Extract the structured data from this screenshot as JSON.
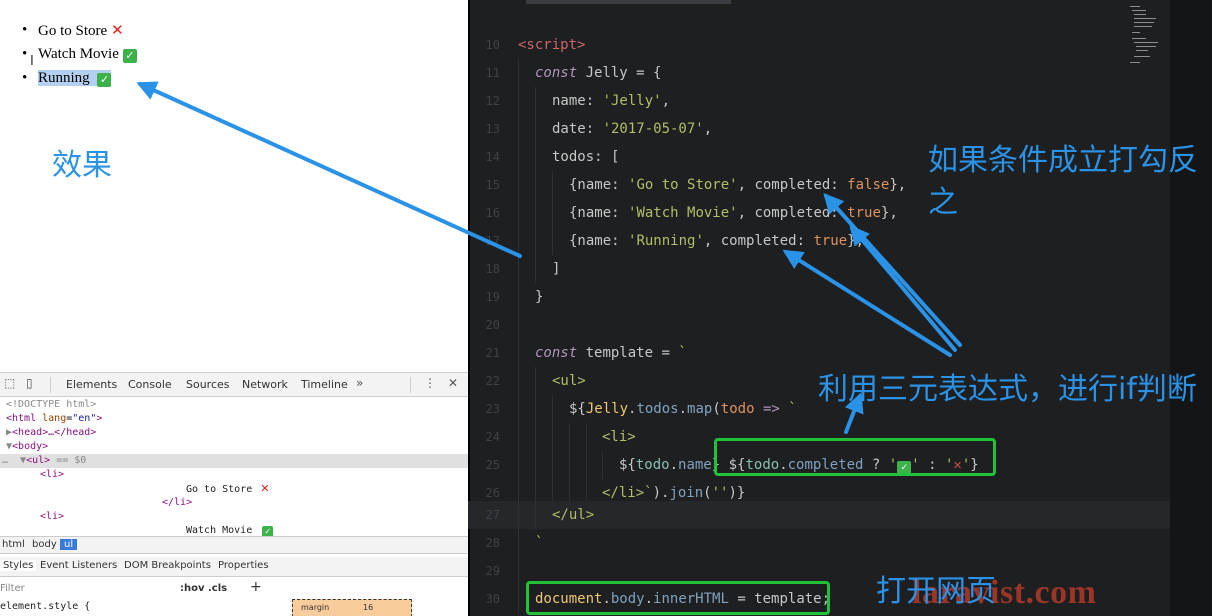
{
  "browser": {
    "todos": [
      {
        "name": "Go to Store",
        "completed": false
      },
      {
        "name": "Watch Movie",
        "completed": true
      },
      {
        "name": "Running",
        "completed": true
      }
    ]
  },
  "annotations": {
    "effect": "效果",
    "condition": "如果条件成立打勾反之",
    "ternary": "利用三元表达式，进行if判断",
    "open_page": "打开网页"
  },
  "icons": {
    "cross": "✕",
    "check": "✓",
    "more_tabs": "»",
    "menu": "⋮",
    "close": "✕",
    "inspect": "⬚",
    "device": "▯",
    "plus": "+"
  },
  "devtools": {
    "tabs": [
      "Elements",
      "Console",
      "Sources",
      "Network",
      "Timeline"
    ],
    "dom": {
      "doctype": "<!DOCTYPE html>",
      "html_open": "<html",
      "lang_attr": "lang",
      "lang_val": "\"en\"",
      "head": "<head>…</head>",
      "body": "<body>",
      "ul": "<ul>",
      "selected_marker": "== $0",
      "li_open": "<li>",
      "li_close": "</li>",
      "item1": "Go to Store",
      "item2": "Watch Movie"
    },
    "breadcrumb": [
      "html",
      "body",
      "ul"
    ],
    "subtabs": [
      "Styles",
      "Event Listeners",
      "DOM Breakpoints",
      "Properties"
    ],
    "filter_placeholder": "Filter",
    "hov_cls": ":hov  .cls",
    "element_style": "element.style {",
    "box_margin_label": "margin",
    "box_margin_value": "16"
  },
  "editor": {
    "line_numbers": [
      "10",
      "11",
      "12",
      "13",
      "14",
      "15",
      "16",
      "17",
      "18",
      "19",
      "20",
      "21",
      "22",
      "23",
      "24",
      "25",
      "26",
      "27",
      "28",
      "29",
      "30"
    ],
    "current_line": "27"
  },
  "watermark": "laravist.com",
  "colors": {
    "annotation_blue": "#2a93e8",
    "highlight_green": "#22c13a",
    "editor_bg": "#1d1f21"
  }
}
